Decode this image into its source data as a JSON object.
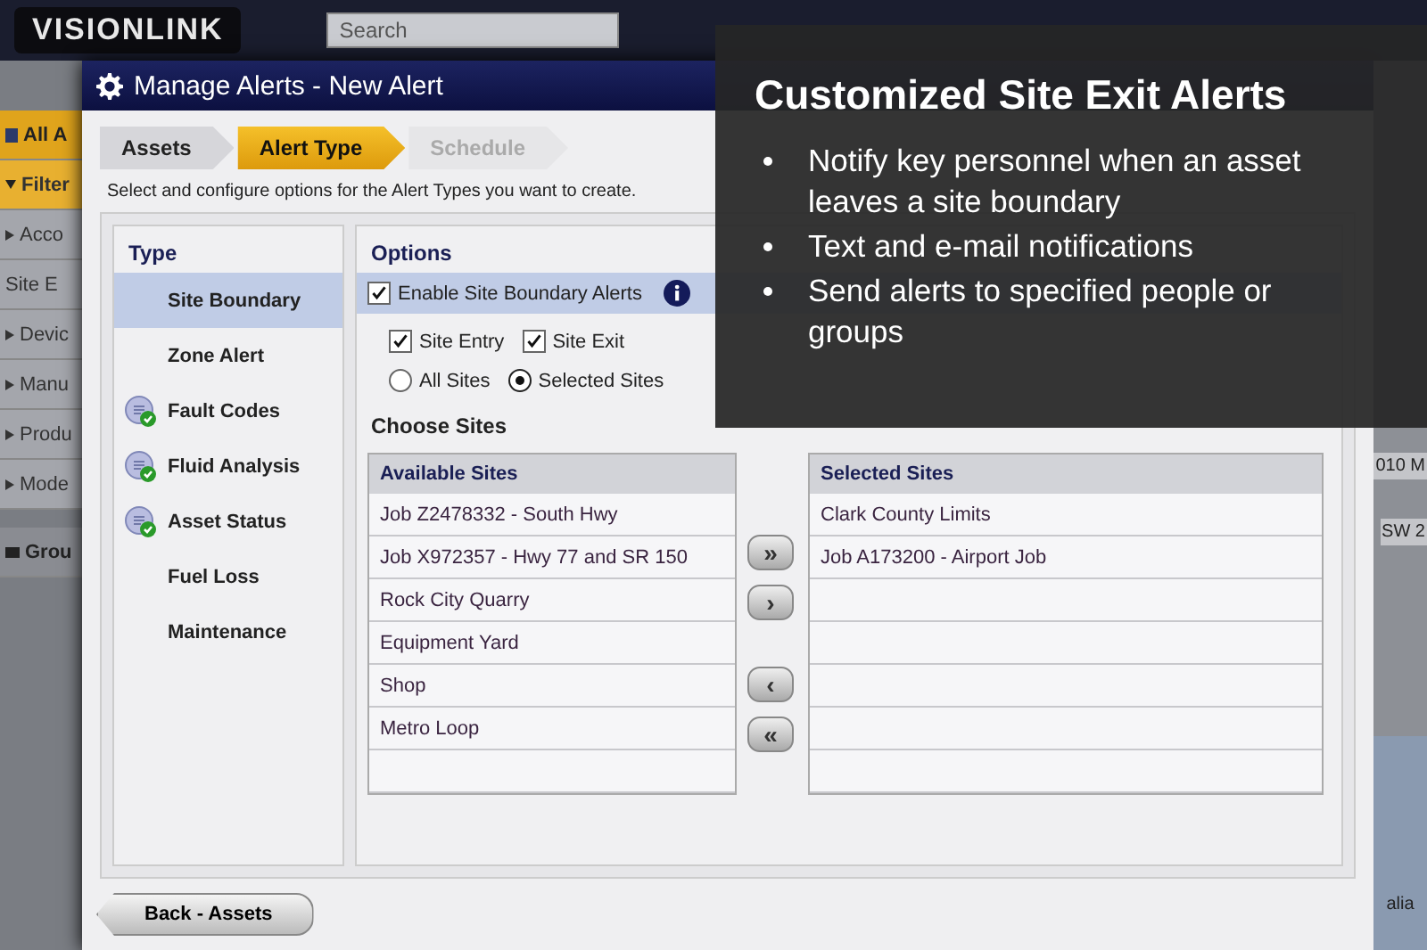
{
  "app": {
    "logo": "VISIONLINK",
    "search": {
      "placeholder": "Search"
    },
    "sidebar": [
      {
        "label": "All A",
        "kind": "header"
      },
      {
        "label": "Filter",
        "kind": "section",
        "expanded": true
      },
      {
        "label": "Acco",
        "kind": "group",
        "expanded": false
      },
      {
        "label": "Site E",
        "kind": "plain"
      },
      {
        "label": "Devic",
        "kind": "group",
        "expanded": false
      },
      {
        "label": "Manu",
        "kind": "group",
        "expanded": false
      },
      {
        "label": "Produ",
        "kind": "group",
        "expanded": false
      },
      {
        "label": "Mode",
        "kind": "group",
        "expanded": false
      },
      {
        "label": "Grou",
        "kind": "folder"
      }
    ],
    "right_fragments": [
      "010 M",
      "SW 2"
    ],
    "map_fragment": "alia"
  },
  "dialog": {
    "title": "Manage Alerts - New Alert",
    "steps": [
      {
        "label": "Assets",
        "selected": false,
        "disabled": false
      },
      {
        "label": "Alert Type",
        "selected": true,
        "disabled": false
      },
      {
        "label": "Schedule",
        "selected": false,
        "disabled": true
      }
    ],
    "instructions": "Select and configure options for the Alert Types you want to create.",
    "type_panel": {
      "heading": "Type",
      "items": [
        {
          "label": "Site Boundary",
          "selected": true,
          "configured": false
        },
        {
          "label": "Zone Alert",
          "selected": false,
          "configured": false
        },
        {
          "label": "Fault Codes",
          "selected": false,
          "configured": true
        },
        {
          "label": "Fluid Analysis",
          "selected": false,
          "configured": true
        },
        {
          "label": "Asset Status",
          "selected": false,
          "configured": true
        },
        {
          "label": "Fuel Loss",
          "selected": false,
          "configured": false
        },
        {
          "label": "Maintenance",
          "selected": false,
          "configured": false
        }
      ]
    },
    "options": {
      "heading": "Options",
      "enable": {
        "label": "Enable Site Boundary Alerts",
        "checked": true
      },
      "triggers": [
        {
          "label": "Site Entry",
          "checked": true
        },
        {
          "label": "Site Exit",
          "checked": true
        }
      ],
      "scope": [
        {
          "label": "All Sites",
          "selected": false
        },
        {
          "label": "Selected Sites",
          "selected": true
        }
      ],
      "choose_heading": "Choose Sites",
      "available": {
        "heading": "Available Sites",
        "items": [
          "Job Z2478332 - South Hwy",
          "Job X972357 - Hwy 77 and SR 150",
          "Rock City Quarry",
          "Equipment Yard",
          "Shop",
          "Metro Loop"
        ]
      },
      "move_buttons": [
        "»",
        "›",
        "‹",
        "«"
      ],
      "selected": {
        "heading": "Selected Sites",
        "items": [
          "Clark County Limits",
          "Job A173200 - Airport Job"
        ]
      }
    },
    "back_button": "Back - Assets"
  },
  "callout": {
    "title": "Customized Site Exit Alerts",
    "bullets": [
      "Notify key personnel when an asset leaves a site boundary",
      "Text and e-mail notifications",
      "Send alerts to specified people or groups"
    ]
  }
}
